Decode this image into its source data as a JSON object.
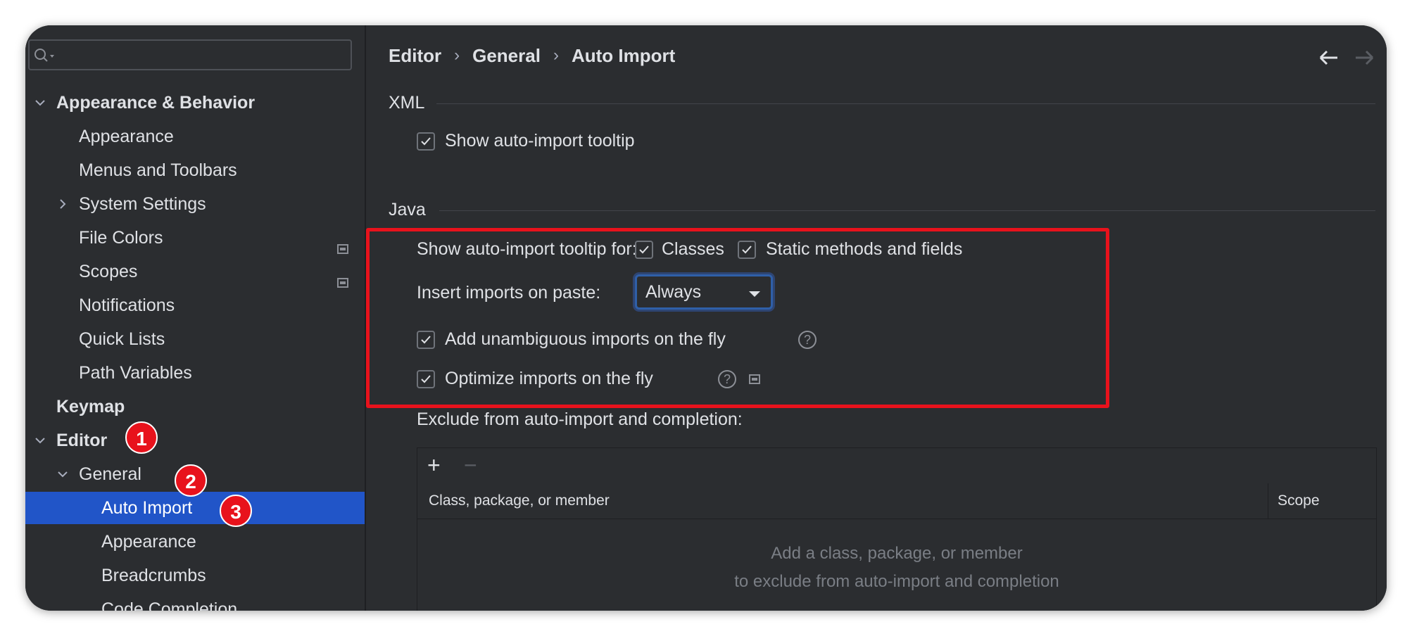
{
  "search": {
    "placeholder": ""
  },
  "sidebar": {
    "items": [
      {
        "label": "Appearance & Behavior",
        "level": 0,
        "bold": true,
        "expanded": true
      },
      {
        "label": "Appearance",
        "level": 1
      },
      {
        "label": "Menus and Toolbars",
        "level": 1
      },
      {
        "label": "System Settings",
        "level": 1,
        "collapsed": true
      },
      {
        "label": "File Colors",
        "level": 1,
        "project_icon": true
      },
      {
        "label": "Scopes",
        "level": 1,
        "project_icon": true
      },
      {
        "label": "Notifications",
        "level": 1
      },
      {
        "label": "Quick Lists",
        "level": 1
      },
      {
        "label": "Path Variables",
        "level": 1
      },
      {
        "label": "Keymap",
        "level": 0,
        "bold": true
      },
      {
        "label": "Editor",
        "level": 0,
        "bold": true,
        "expanded": true
      },
      {
        "label": "General",
        "level": 1,
        "expanded": true
      },
      {
        "label": "Auto Import",
        "level": 2,
        "selected": true
      },
      {
        "label": "Appearance",
        "level": 2
      },
      {
        "label": "Breadcrumbs",
        "level": 2
      },
      {
        "label": "Code Completion",
        "level": 2
      }
    ]
  },
  "annotations": {
    "badge1": "1",
    "badge2": "2",
    "badge3": "3"
  },
  "breadcrumb": {
    "part1": "Editor",
    "part2": "General",
    "part3": "Auto Import",
    "sep": "›"
  },
  "xml": {
    "title": "XML",
    "show_tooltip_label": "Show auto-import tooltip",
    "show_tooltip_checked": true
  },
  "java": {
    "title": "Java",
    "tooltip_for_label": "Show auto-import tooltip for:",
    "classes_label": "Classes",
    "classes_checked": true,
    "static_label": "Static methods and fields",
    "static_checked": true,
    "insert_label": "Insert imports on paste:",
    "insert_value": "Always",
    "unambiguous_label": "Add unambiguous imports on the fly",
    "unambiguous_checked": true,
    "optimize_label": "Optimize imports on the fly",
    "optimize_checked": true,
    "exclude_label": "Exclude from auto-import and completion:"
  },
  "table": {
    "add_label": "+",
    "remove_label": "−",
    "col1": "Class, package, or member",
    "col2": "Scope",
    "empty_line1": "Add a class, package, or member",
    "empty_line2": "to exclude from auto-import and completion"
  },
  "colors": {
    "background": "#2b2d30",
    "selection": "#2155c8",
    "highlight_border": "#e8121c",
    "text": "#dfe1e5"
  }
}
